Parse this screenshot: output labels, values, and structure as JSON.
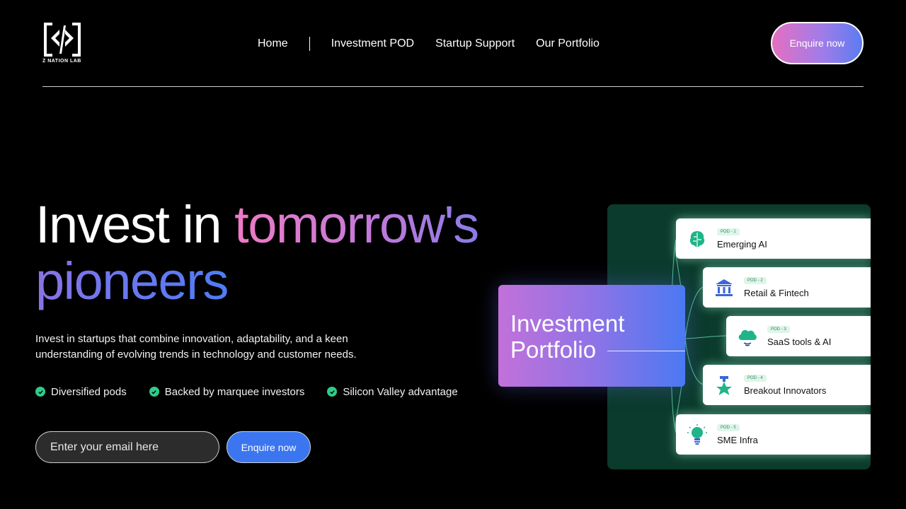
{
  "logo": {
    "text": "Z NATION LAB"
  },
  "nav": {
    "items": [
      "Home",
      "Investment POD",
      "Startup Support",
      "Our Portfolio"
    ]
  },
  "header": {
    "cta_label": "Enquire now"
  },
  "hero": {
    "title_part1": "Invest in ",
    "title_part2": "tomorrow's",
    "title_part3": "pioneers",
    "description": "Invest in startups that combine innovation, adaptability, and a keen understanding of evolving trends in technology and customer needs.",
    "features": [
      "Diversified pods",
      "Backed by marquee investors",
      "Silicon Valley advantage"
    ],
    "email_placeholder": "Enter your email here",
    "cta_label": "Enquire now"
  },
  "portfolio": {
    "line1": "Investment",
    "line2": "Portfolio",
    "pods": [
      {
        "tag": "POD - 1",
        "name": "Emerging AI",
        "icon": "brain-icon"
      },
      {
        "tag": "POD - 2",
        "name": "Retail & Fintech",
        "icon": "bank-icon"
      },
      {
        "tag": "POD - 3",
        "name": "SaaS tools & AI",
        "icon": "cloud-icon"
      },
      {
        "tag": "POD - 4",
        "name": "Breakout Innovators",
        "icon": "trophy-star-icon"
      },
      {
        "tag": "POD - 5",
        "name": "SME Infra",
        "icon": "lightbulb-icon"
      }
    ]
  },
  "colors": {
    "background": "#000000",
    "accent_blue": "#3b76f0",
    "accent_pink": "#ef7ac4",
    "check_green": "#2ecc8b",
    "diagram_bg": "#0b3b2c"
  }
}
